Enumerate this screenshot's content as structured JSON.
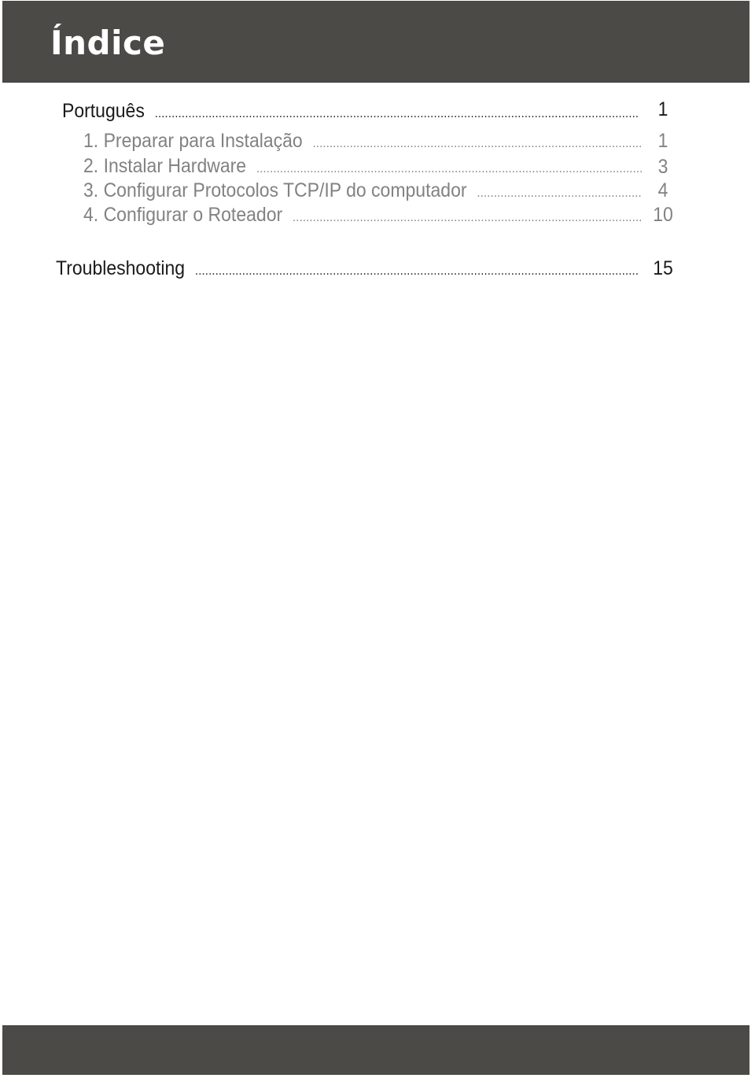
{
  "header": {
    "title": "Índice"
  },
  "toc": {
    "sections": [
      {
        "label": "Português",
        "page": "1",
        "level": 1
      },
      {
        "label": "1. Preparar para Instalação",
        "page": "1",
        "level": 2
      },
      {
        "label": "2. Instalar Hardware",
        "page": "3",
        "level": 2
      },
      {
        "label": "3. Configurar Protocolos TCP/IP do computador",
        "page": "4",
        "level": 2
      },
      {
        "label": "4. Configurar o Roteador",
        "page": "10",
        "level": 2
      },
      {
        "label": "Troubleshooting",
        "page": "15",
        "level": 1
      }
    ]
  },
  "colors": {
    "band": "#4b4a46",
    "primary_text": "#1a1a1a",
    "secondary_text": "#828282",
    "title_text": "#ffffff"
  }
}
